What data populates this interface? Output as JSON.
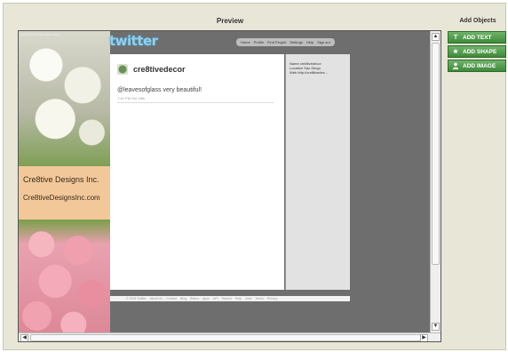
{
  "app": {
    "preview_title": "Preview",
    "add_objects_title": "Add Objects"
  },
  "buttons": [
    {
      "label": "ADD TEXT",
      "icon": "text-icon"
    },
    {
      "label": "ADD SHAPE",
      "icon": "star-icon"
    },
    {
      "label": "ADD IMAGE",
      "icon": "person-icon"
    }
  ],
  "theme": {
    "top_caption": "cre8tive.DesignsInc.com",
    "logo": "twitter",
    "banner_title": "Cre8tive Designs Inc.",
    "banner_url": "Cre8tiveDesignsInc.com"
  },
  "nav": [
    "Home",
    "Profile",
    "Find People",
    "Settings",
    "Help",
    "Sign out"
  ],
  "profile": {
    "name": "cre8tivedecor",
    "tweet": "@leavesofglass very beautiful!",
    "tweet_meta": "7:41 PM Oct 18th"
  },
  "sidebar": {
    "name": "Name cre8tivedecor",
    "location": "Location San Diego",
    "web": "Web http://cre8tivedec..."
  },
  "footer": [
    "© 2009 Twitter",
    "About Us",
    "Contact",
    "Blog",
    "Status",
    "Apps",
    "API",
    "Search",
    "Help",
    "Jobs",
    "Terms",
    "Privacy"
  ],
  "colors": {
    "button_green": "#4a9a45",
    "preview_bg": "#6e6e6e",
    "twitter_logo": "#8fd0ef"
  }
}
